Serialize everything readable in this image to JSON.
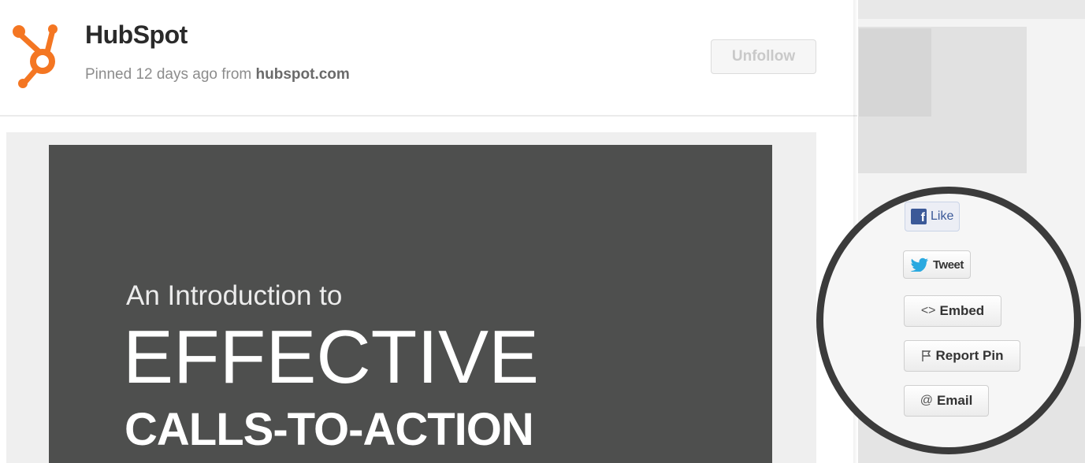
{
  "pin": {
    "author": "HubSpot",
    "meta_prefix": "Pinned 12 days ago from",
    "source": "hubspot.com",
    "follow_label": "Unfollow",
    "image_text": {
      "line1": "An Introduction to",
      "line2": "EFFECTIVE",
      "line3": "CALLS-TO-ACTION"
    }
  },
  "share": {
    "like_label": "Like",
    "tweet_label": "Tweet",
    "embed_label": "Embed",
    "report_label": "Report Pin",
    "email_label": "Email"
  },
  "icons": {
    "logo": "hubspot-sprocket-logo",
    "like": "facebook-f-icon",
    "tweet": "twitter-bird-icon",
    "embed": "code-brackets-icon",
    "report": "flag-icon",
    "email": "at-sign-icon"
  },
  "colors": {
    "brand_orange": "#f47622",
    "pin_image_bg": "#4e4f4e",
    "facebook_blue": "#3b5998",
    "twitter_blue": "#2aa9e0",
    "circle_outline": "#3b3b3b"
  }
}
